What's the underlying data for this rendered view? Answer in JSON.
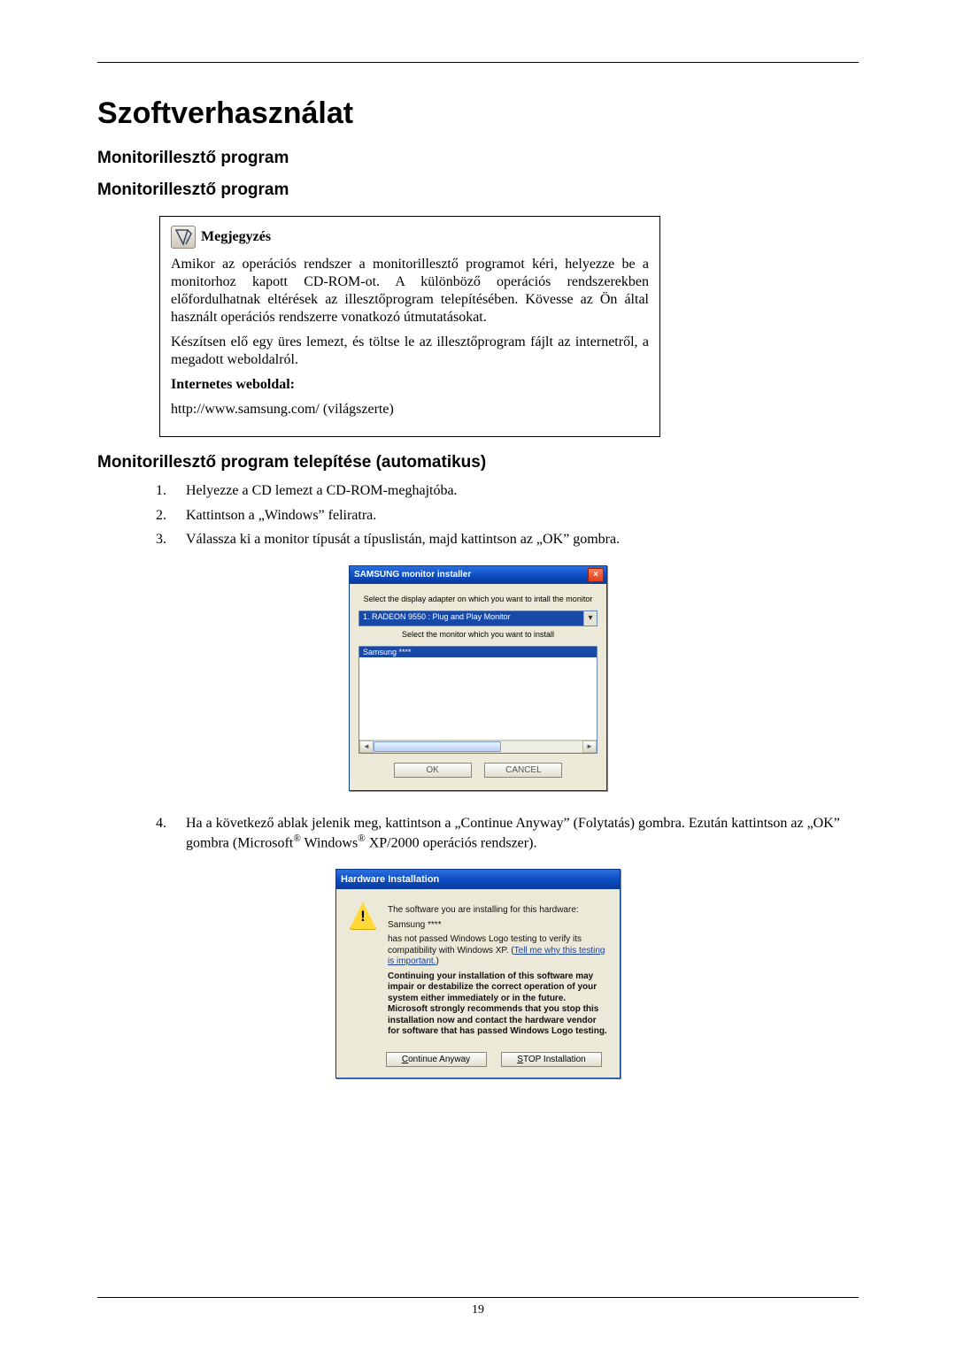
{
  "page_number": "19",
  "title": "Szoftverhasználat",
  "section1": "Monitorillesztő program",
  "section2": "Monitorillesztő program",
  "note": {
    "heading": "Megjegyzés",
    "p1": "Amikor az operációs rendszer a monitorillesztő programot kéri, helyezze be a monitorhoz kapott CD-ROM-ot. A különböző operációs rendszerekben előfordulhatnak eltérések az illesztőprogram telepítésében. Kövesse az Ön által használt operációs rendszerre vonatkozó útmutatásokat.",
    "p2": "Készítsen elő egy üres lemezt, és töltse le az illesztőprogram fájlt az internetről, a megadott weboldalról.",
    "label": "Internetes weboldal:",
    "url": "http://www.samsung.com/ (világszerte)"
  },
  "section3": "Monitorillesztő program telepítése (automatikus)",
  "steps": {
    "s1": "Helyezze a CD lemezt a CD-ROM-meghajtóba.",
    "s2": "Kattintson a „Windows” feliratra.",
    "s3": "Válassza ki a monitor típusát a típuslistán, majd kattintson az „OK” gombra.",
    "s4a": "Ha a következő ablak jelenik meg, kattintson a „Continue Anyway” (Folytatás) gombra. Ezután kattintson az „OK” gombra (Microsoft",
    "s4b": " Windows",
    "s4c": " XP/2000 operációs rendszer)."
  },
  "installer": {
    "title": "SAMSUNG monitor installer",
    "hint1": "Select the display adapter on which you want to intall the monitor",
    "select_value": "1. RADEON 9550 : Plug and Play Monitor",
    "hint2": "Select the monitor which you want to install",
    "list_item": "Samsung ****",
    "btn_ok": "OK",
    "btn_cancel": "CANCEL"
  },
  "hw": {
    "title": "Hardware Installation",
    "p1": "The software you are installing for this hardware:",
    "p2": "Samsung ****",
    "p3a": "has not passed Windows Logo testing to verify its compatibility with Windows XP. (",
    "link": "Tell me why this testing is important.",
    "p3b": ")",
    "p4": "Continuing your installation of this software may impair or destabilize the correct operation of your system either immediately or in the future. Microsoft strongly recommends that you stop this installation now and contact the hardware vendor for software that has passed Windows Logo testing.",
    "btn_continue_u": "C",
    "btn_continue_rest": "ontinue Anyway",
    "btn_stop_u": "S",
    "btn_stop_rest": "TOP Installation"
  }
}
